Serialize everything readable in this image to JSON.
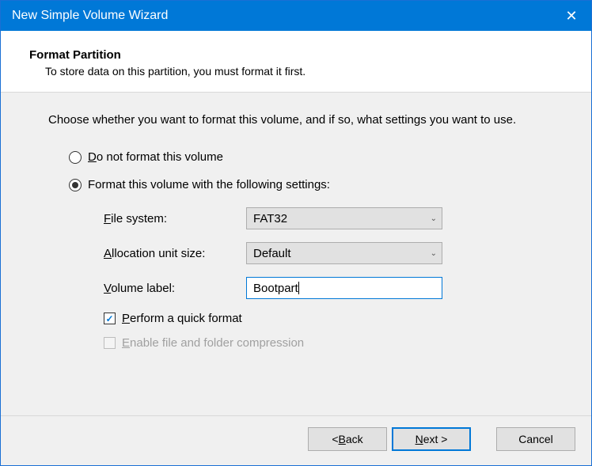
{
  "window": {
    "title": "New Simple Volume Wizard"
  },
  "header": {
    "title": "Format Partition",
    "subtitle": "To store data on this partition, you must format it first."
  },
  "content": {
    "instruction": "Choose whether you want to format this volume, and if so, what settings you want to use.",
    "radio_noformat_pre": "D",
    "radio_noformat_rest": "o not format this volume",
    "radio_format": "Format this volume with the following settings:",
    "filesystem_label_pre": "F",
    "filesystem_label_rest": "ile system:",
    "filesystem_value": "FAT32",
    "alloc_label_pre": "A",
    "alloc_label_rest": "llocation unit size:",
    "alloc_value": "Default",
    "volume_label_pre": "V",
    "volume_label_rest": "olume label:",
    "volume_value": "Bootpart",
    "quickformat_pre": "P",
    "quickformat_rest": "erform a quick format",
    "compression_pre": "E",
    "compression_rest": "nable file and folder compression"
  },
  "footer": {
    "back_lt": "< ",
    "back_pre": "B",
    "back_rest": "ack",
    "next_pre": "N",
    "next_rest": "ext >",
    "cancel": "Cancel"
  }
}
